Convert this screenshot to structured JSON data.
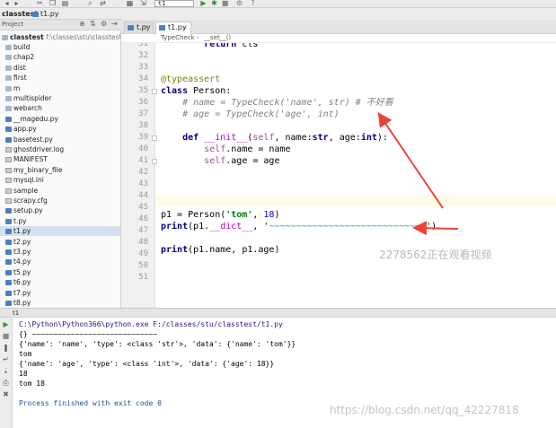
{
  "toolbar": {
    "run_config": "t1",
    "icons": [
      "back-icon",
      "forward-icon",
      "cut-icon",
      "copy-icon",
      "paste-icon",
      "find-icon",
      "replace-icon",
      "run-icon",
      "debug-icon",
      "stop-icon",
      "build-icon",
      "help-icon"
    ]
  },
  "nav": {
    "project": "classtest",
    "file": "t1.py"
  },
  "project_panel": {
    "label": "Project",
    "root_name": "classtest",
    "root_path": "f:\\classes\\stu\\classtest",
    "items": [
      {
        "name": "build",
        "type": "folder"
      },
      {
        "name": "chap2",
        "type": "folder"
      },
      {
        "name": "dist",
        "type": "folder"
      },
      {
        "name": "first",
        "type": "folder"
      },
      {
        "name": "m",
        "type": "folder"
      },
      {
        "name": "multispider",
        "type": "folder"
      },
      {
        "name": "webarch",
        "type": "folder"
      },
      {
        "name": "__magedu.py",
        "type": "py"
      },
      {
        "name": "app.py",
        "type": "py"
      },
      {
        "name": "basetest.py",
        "type": "py"
      },
      {
        "name": "ghostdriver.log",
        "type": "file"
      },
      {
        "name": "MANIFEST",
        "type": "file"
      },
      {
        "name": "my_binary_file",
        "type": "file"
      },
      {
        "name": "mysql.ini",
        "type": "file"
      },
      {
        "name": "sample",
        "type": "file"
      },
      {
        "name": "scrapy.cfg",
        "type": "file"
      },
      {
        "name": "setup.py",
        "type": "py"
      },
      {
        "name": "t.py",
        "type": "py"
      },
      {
        "name": "t1.py",
        "type": "py",
        "selected": true
      },
      {
        "name": "t2.py",
        "type": "py"
      },
      {
        "name": "t3.py",
        "type": "py"
      },
      {
        "name": "t4.py",
        "type": "py"
      },
      {
        "name": "t5.py",
        "type": "py"
      },
      {
        "name": "t6.py",
        "type": "py"
      },
      {
        "name": "t7.py",
        "type": "py"
      },
      {
        "name": "t8.py",
        "type": "py"
      }
    ]
  },
  "tabs": [
    {
      "label": "t.py",
      "active": false
    },
    {
      "label": "t1.py",
      "active": true
    }
  ],
  "structure": {
    "class": "TypeCheck",
    "method": "__set__()"
  },
  "editor": {
    "line_numbers": [
      "31",
      "32",
      "33",
      "34",
      "35",
      "36",
      "37",
      "38",
      "39",
      "40",
      "41",
      "42",
      "43",
      "44",
      "45",
      "46",
      "47",
      "48",
      "49",
      "50",
      "51"
    ]
  },
  "run_panel": {
    "title": "t1",
    "lines": [
      "C:\\Python\\Python366\\python.exe F:/classes/stu/classtest/t1.py",
      "{} ~~~~~~~~~~~~~~~~~~~~~~~~~~~~~",
      "{'name': 'name', 'type': <class 'str'>, 'data': {'name': 'tom'}}",
      "tom",
      "{'name': 'age', 'type': <class 'int'>, 'data': {'age': 18}}",
      "18",
      "tom 18",
      "",
      "Process finished with exit code 0"
    ]
  },
  "watermarks": {
    "video": "2278562正在观看视频",
    "blog": "https://blog.csdn.net/qq_42227818"
  },
  "colors": {
    "keyword": "#000080",
    "decorator": "#808000",
    "string": "#008000",
    "comment": "#808080",
    "self": "#94558d",
    "annotation_arrow": "#e8443b"
  }
}
